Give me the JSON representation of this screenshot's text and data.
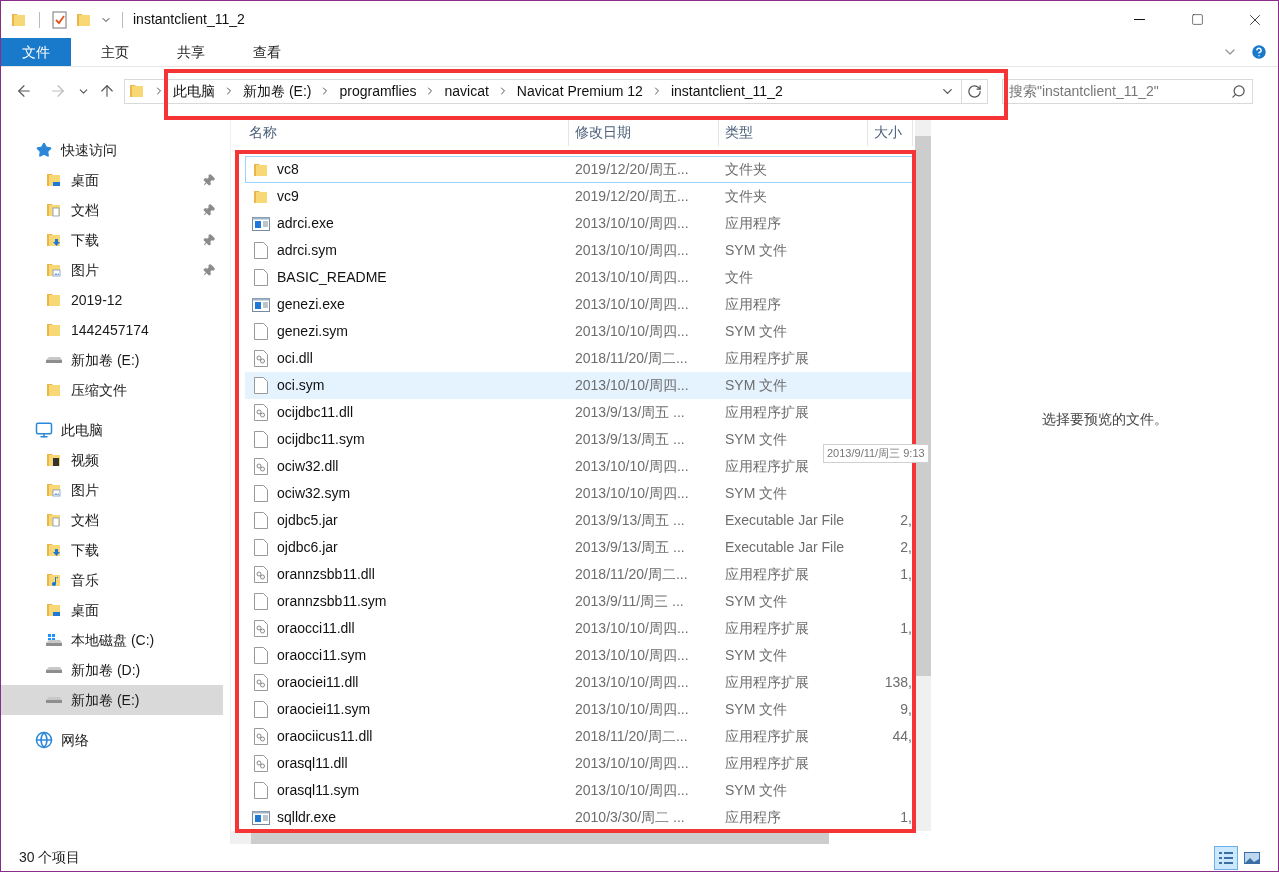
{
  "window": {
    "title": "instantclient_11_2"
  },
  "ribbon_tabs": [
    {
      "label": "文件",
      "kind": "file"
    },
    {
      "label": "主页",
      "kind": "tab"
    },
    {
      "label": "共享",
      "kind": "tab"
    },
    {
      "label": "查看",
      "kind": "tab"
    }
  ],
  "address_bar": {
    "breadcrumbs": [
      "此电脑",
      "新加卷 (E:)",
      "programflies",
      "navicat",
      "Navicat Premium 12",
      "instantclient_11_2"
    ]
  },
  "search": {
    "placeholder": "搜索\"instantclient_11_2\""
  },
  "sidebar": {
    "groups": [
      {
        "label": "快速访问",
        "kind": "star",
        "children": [
          {
            "label": "桌面",
            "kind": "desktop",
            "pinned": true,
            "selected": false
          },
          {
            "label": "文档",
            "kind": "docs",
            "pinned": true,
            "selected": false
          },
          {
            "label": "下载",
            "kind": "download",
            "pinned": true,
            "selected": false
          },
          {
            "label": "图片",
            "kind": "pictures",
            "pinned": true,
            "selected": false
          },
          {
            "label": "2019-12",
            "kind": "folder",
            "pinned": false,
            "selected": false
          },
          {
            "label": "1442457174",
            "kind": "folder",
            "pinned": false,
            "selected": false
          },
          {
            "label": "新加卷 (E:)",
            "kind": "drive",
            "pinned": false,
            "selected": false
          },
          {
            "label": "压缩文件",
            "kind": "folder",
            "pinned": false,
            "selected": false
          }
        ]
      },
      {
        "label": "此电脑",
        "kind": "computer",
        "children": [
          {
            "label": "视频",
            "kind": "video",
            "pinned": false,
            "selected": false
          },
          {
            "label": "图片",
            "kind": "pictures",
            "pinned": false,
            "selected": false
          },
          {
            "label": "文档",
            "kind": "docs",
            "pinned": false,
            "selected": false
          },
          {
            "label": "下载",
            "kind": "download",
            "pinned": false,
            "selected": false
          },
          {
            "label": "音乐",
            "kind": "music",
            "pinned": false,
            "selected": false
          },
          {
            "label": "桌面",
            "kind": "desktop",
            "pinned": false,
            "selected": false
          },
          {
            "label": "本地磁盘 (C:)",
            "kind": "windrive",
            "pinned": false,
            "selected": false
          },
          {
            "label": "新加卷 (D:)",
            "kind": "drive",
            "pinned": false,
            "selected": false
          },
          {
            "label": "新加卷 (E:)",
            "kind": "drive",
            "pinned": false,
            "selected": true
          }
        ]
      },
      {
        "label": "网络",
        "kind": "network"
      }
    ]
  },
  "table": {
    "columns": [
      "名称",
      "修改日期",
      "类型",
      "大小"
    ],
    "rows": [
      {
        "name": "vc8",
        "kind": "folder",
        "date": "2019/12/20/周五...",
        "type": "文件夹",
        "focused": true,
        "selected": false
      },
      {
        "name": "vc9",
        "kind": "folder",
        "date": "2019/12/20/周五...",
        "type": "文件夹",
        "focused": false,
        "selected": false
      },
      {
        "name": "adrci.exe",
        "kind": "exe",
        "date": "2013/10/10/周四...",
        "type": "应用程序",
        "focused": false,
        "selected": false
      },
      {
        "name": "adrci.sym",
        "kind": "file",
        "date": "2013/10/10/周四...",
        "type": "SYM 文件",
        "focused": false,
        "selected": false
      },
      {
        "name": "BASIC_README",
        "kind": "file",
        "date": "2013/10/10/周四...",
        "type": "文件",
        "focused": false,
        "selected": false
      },
      {
        "name": "genezi.exe",
        "kind": "exe",
        "date": "2013/10/10/周四...",
        "type": "应用程序",
        "focused": false,
        "selected": false
      },
      {
        "name": "genezi.sym",
        "kind": "file",
        "date": "2013/10/10/周四...",
        "type": "SYM 文件",
        "focused": false,
        "selected": false
      },
      {
        "name": "oci.dll",
        "kind": "dll",
        "date": "2018/11/20/周二...",
        "type": "应用程序扩展",
        "focused": false,
        "selected": false
      },
      {
        "name": "oci.sym",
        "kind": "file",
        "date": "2013/10/10/周四...",
        "type": "SYM 文件",
        "focused": false,
        "selected": true
      },
      {
        "name": "ocijdbc11.dll",
        "kind": "dll",
        "date": "2013/9/13/周五 ...",
        "type": "应用程序扩展",
        "focused": false,
        "selected": false
      },
      {
        "name": "ocijdbc11.sym",
        "kind": "file",
        "date": "2013/9/13/周五 ...",
        "type": "SYM 文件",
        "focused": false,
        "selected": false
      },
      {
        "name": "ociw32.dll",
        "kind": "dll",
        "date": "2013/10/10/周四...",
        "type": "应用程序扩展",
        "focused": false,
        "selected": false,
        "tooltip": "2013/9/11/周三 9:13"
      },
      {
        "name": "ociw32.sym",
        "kind": "file",
        "date": "2013/10/10/周四...",
        "type": "SYM 文件",
        "focused": false,
        "selected": false
      },
      {
        "name": "ojdbc5.jar",
        "kind": "file",
        "date": "2013/9/13/周五 ...",
        "type": "Executable Jar File",
        "size": "2,",
        "focused": false,
        "selected": false
      },
      {
        "name": "ojdbc6.jar",
        "kind": "file",
        "date": "2013/9/13/周五 ...",
        "type": "Executable Jar File",
        "size": "2,",
        "focused": false,
        "selected": false
      },
      {
        "name": "orannzsbb11.dll",
        "kind": "dll",
        "date": "2018/11/20/周二...",
        "type": "应用程序扩展",
        "size": "1,",
        "focused": false,
        "selected": false
      },
      {
        "name": "orannzsbb11.sym",
        "kind": "file",
        "date": "2013/9/11/周三 ...",
        "type": "SYM 文件",
        "focused": false,
        "selected": false
      },
      {
        "name": "oraocci11.dll",
        "kind": "dll",
        "date": "2013/10/10/周四...",
        "type": "应用程序扩展",
        "size": "1,",
        "focused": false,
        "selected": false
      },
      {
        "name": "oraocci11.sym",
        "kind": "file",
        "date": "2013/10/10/周四...",
        "type": "SYM 文件",
        "focused": false,
        "selected": false
      },
      {
        "name": "oraociei11.dll",
        "kind": "dll",
        "date": "2013/10/10/周四...",
        "type": "应用程序扩展",
        "size": "138,",
        "focused": false,
        "selected": false
      },
      {
        "name": "oraociei11.sym",
        "kind": "file",
        "date": "2013/10/10/周四...",
        "type": "SYM 文件",
        "size": "9,",
        "focused": false,
        "selected": false
      },
      {
        "name": "oraociicus11.dll",
        "kind": "dll",
        "date": "2018/11/20/周二...",
        "type": "应用程序扩展",
        "size": "44,",
        "focused": false,
        "selected": false
      },
      {
        "name": "orasql11.dll",
        "kind": "dll",
        "date": "2013/10/10/周四...",
        "type": "应用程序扩展",
        "focused": false,
        "selected": false
      },
      {
        "name": "orasql11.sym",
        "kind": "file",
        "date": "2013/10/10/周四...",
        "type": "SYM 文件",
        "focused": false,
        "selected": false
      },
      {
        "name": "sqlldr.exe",
        "kind": "exe",
        "date": "2010/3/30/周二 ...",
        "type": "应用程序",
        "size": "1,",
        "focused": false,
        "selected": false
      }
    ]
  },
  "preview": {
    "message": "选择要预览的文件。"
  },
  "status_bar": {
    "item_count": "30 个项目"
  }
}
